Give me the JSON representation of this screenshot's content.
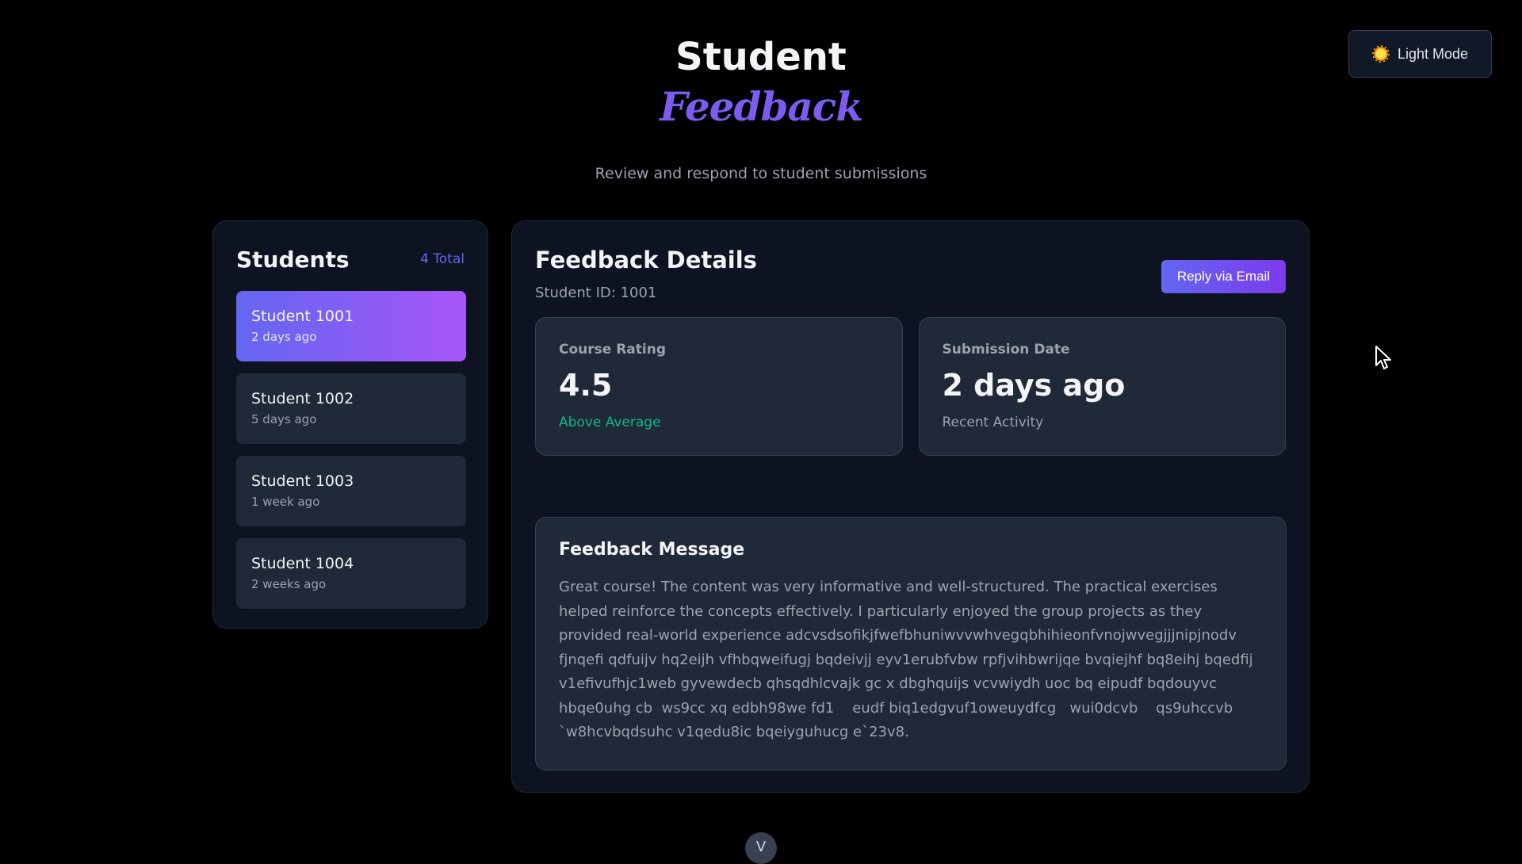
{
  "header": {
    "title_line1": "Student",
    "title_line2": "Feedback",
    "subtitle": "Review and respond to student submissions"
  },
  "theme_toggle": {
    "icon": "sun-icon",
    "label": "Light Mode"
  },
  "students": {
    "title": "Students",
    "total": "4 Total",
    "items": [
      {
        "name": "Student 1001",
        "time": "2 days ago",
        "active": true
      },
      {
        "name": "Student 1002",
        "time": "5 days ago",
        "active": false
      },
      {
        "name": "Student 1003",
        "time": "1 week ago",
        "active": false
      },
      {
        "name": "Student 1004",
        "time": "2 weeks ago",
        "active": false
      }
    ]
  },
  "details": {
    "title": "Feedback Details",
    "student_id": "Student ID: 1001",
    "reply_label": "Reply via Email",
    "rating": {
      "label": "Course Rating",
      "value": "4.5",
      "note": "Above Average"
    },
    "submission": {
      "label": "Submission Date",
      "value": "2 days ago",
      "note": "Recent Activity"
    },
    "message": {
      "title": "Feedback Message",
      "body": "Great course! The content was very informative and well-structured. The practical exercises helped reinforce the concepts effectively. I particularly enjoyed the group projects as they provided real-world experience adcvsdsofikjfwefbhuniwvvwhvegqbhihieonfvnojwvegjjjnipjnodv fjnqefi qdfuijv hq2eijh vfhbqweifugj bqdeivjj eyv1erubfvbw rpfjvihbwrijqe bvqiejhf bq8eihj bqedfij v1efivufhjc1web gyvewdecb qhsqdhlcvajk gc x dbghquijs vcvwiydh uoc bq eipudf bqdouyvc hbqe0uhg cb  ws9cc xq edbh98we fd1    eudf biq1edgvuf1oweuydfcg   wui0dcvb    qs9uhccvb `w8hcvbqdsuhc v1qedu8ic bqeiyguhucg e`23v8."
    }
  },
  "scroll_button": {
    "icon": "chevron-down-icon",
    "glyph": "V"
  },
  "colors": {
    "accent": "#6366f1",
    "accent_end": "#a855f7",
    "positive": "#10b981",
    "background": "#000000",
    "panel": "#0d1320",
    "card": "#1f2937"
  }
}
